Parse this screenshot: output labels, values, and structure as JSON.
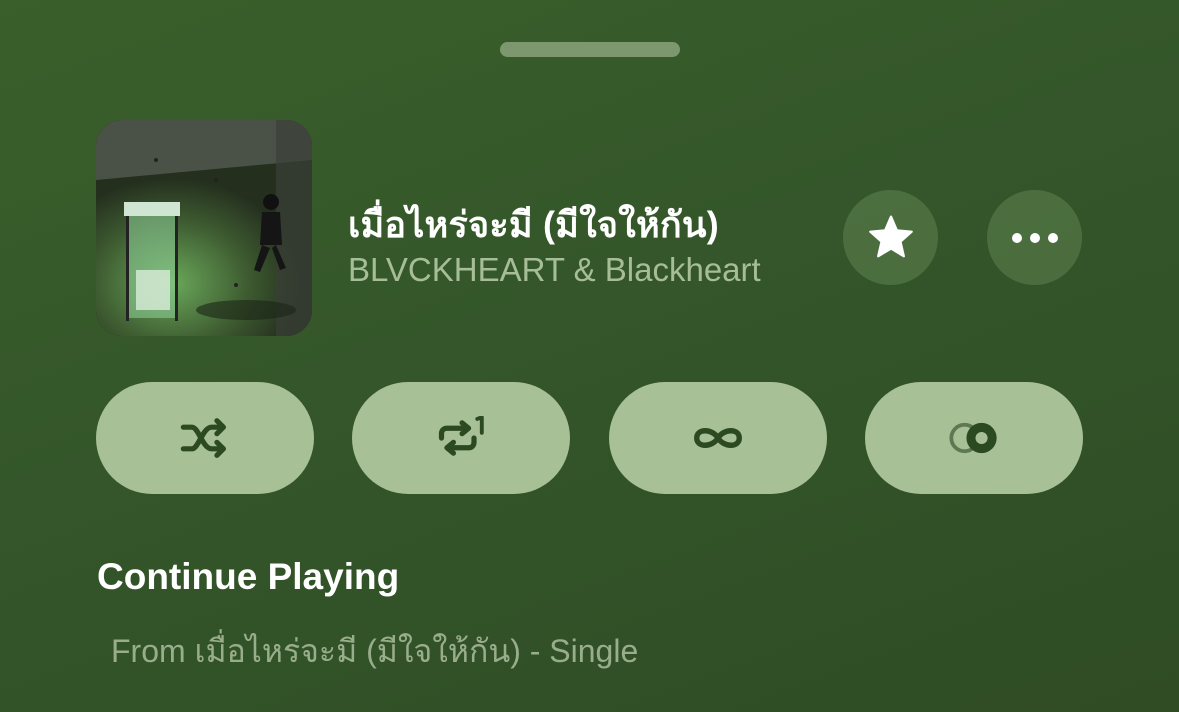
{
  "colors": {
    "background": "#34562a",
    "title_text": "#ffffff",
    "secondary_text": "#a6bd98",
    "pill_background": "#a7c096",
    "pill_icon": "#2c4a22"
  },
  "now_playing": {
    "title": "เมื่อไหร่จะมี (มีใจให้กัน)",
    "artist": "BLVCKHEART & Blackheart",
    "artwork_icon": "album-artwork",
    "actions": [
      {
        "icon": "star-icon"
      },
      {
        "icon": "more-icon"
      }
    ]
  },
  "controls": [
    {
      "icon": "shuffle-icon"
    },
    {
      "icon": "repeat-one-icon"
    },
    {
      "icon": "infinity-icon"
    },
    {
      "icon": "crossfade-icon"
    }
  ],
  "queue": {
    "section_title": "Continue Playing",
    "source": "From เมื่อไหร่จะมี (มีใจให้กัน) - Single"
  }
}
